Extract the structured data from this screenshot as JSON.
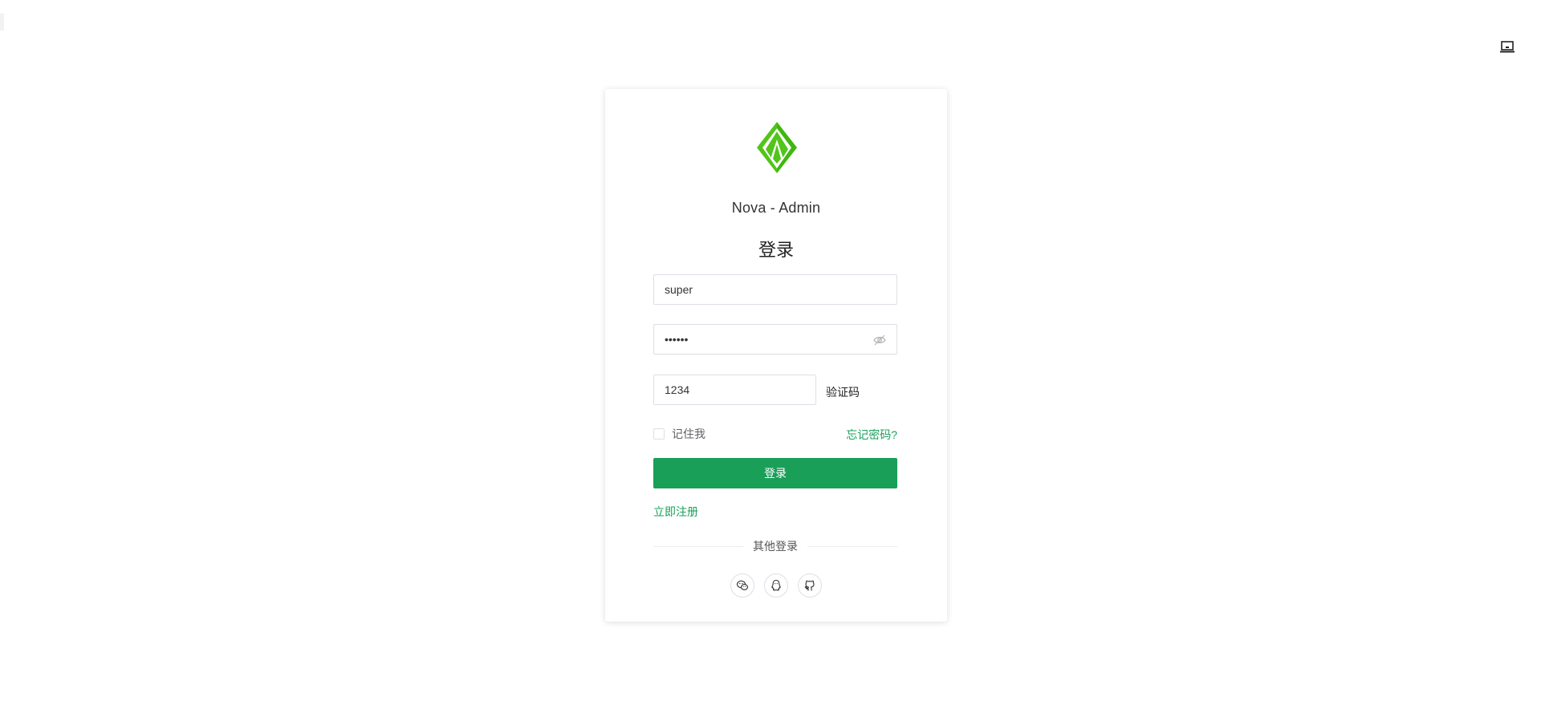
{
  "window": {
    "layout_toggle_icon": "laptop-icon"
  },
  "login_card": {
    "logo_icon": "nova-leaf-logo",
    "brand_color": "#52c41a",
    "app_title": "Nova - Admin",
    "heading": "登录",
    "username": {
      "value": "super",
      "placeholder": ""
    },
    "password": {
      "value": "••••••",
      "placeholder": "",
      "toggle_icon": "eye-off-icon"
    },
    "captcha": {
      "value": "1234",
      "placeholder": "",
      "image_text": "验证码"
    },
    "remember_label": "记住我",
    "remember_checked": false,
    "forgot_label": "忘记密码?",
    "submit_label": "登录",
    "submit_color": "#1a9f59",
    "register_label": "立即注册",
    "other_login_label": "其他登录",
    "social": [
      {
        "name": "wechat",
        "icon": "wechat-icon"
      },
      {
        "name": "qq",
        "icon": "qq-icon"
      },
      {
        "name": "github",
        "icon": "github-icon"
      }
    ]
  }
}
